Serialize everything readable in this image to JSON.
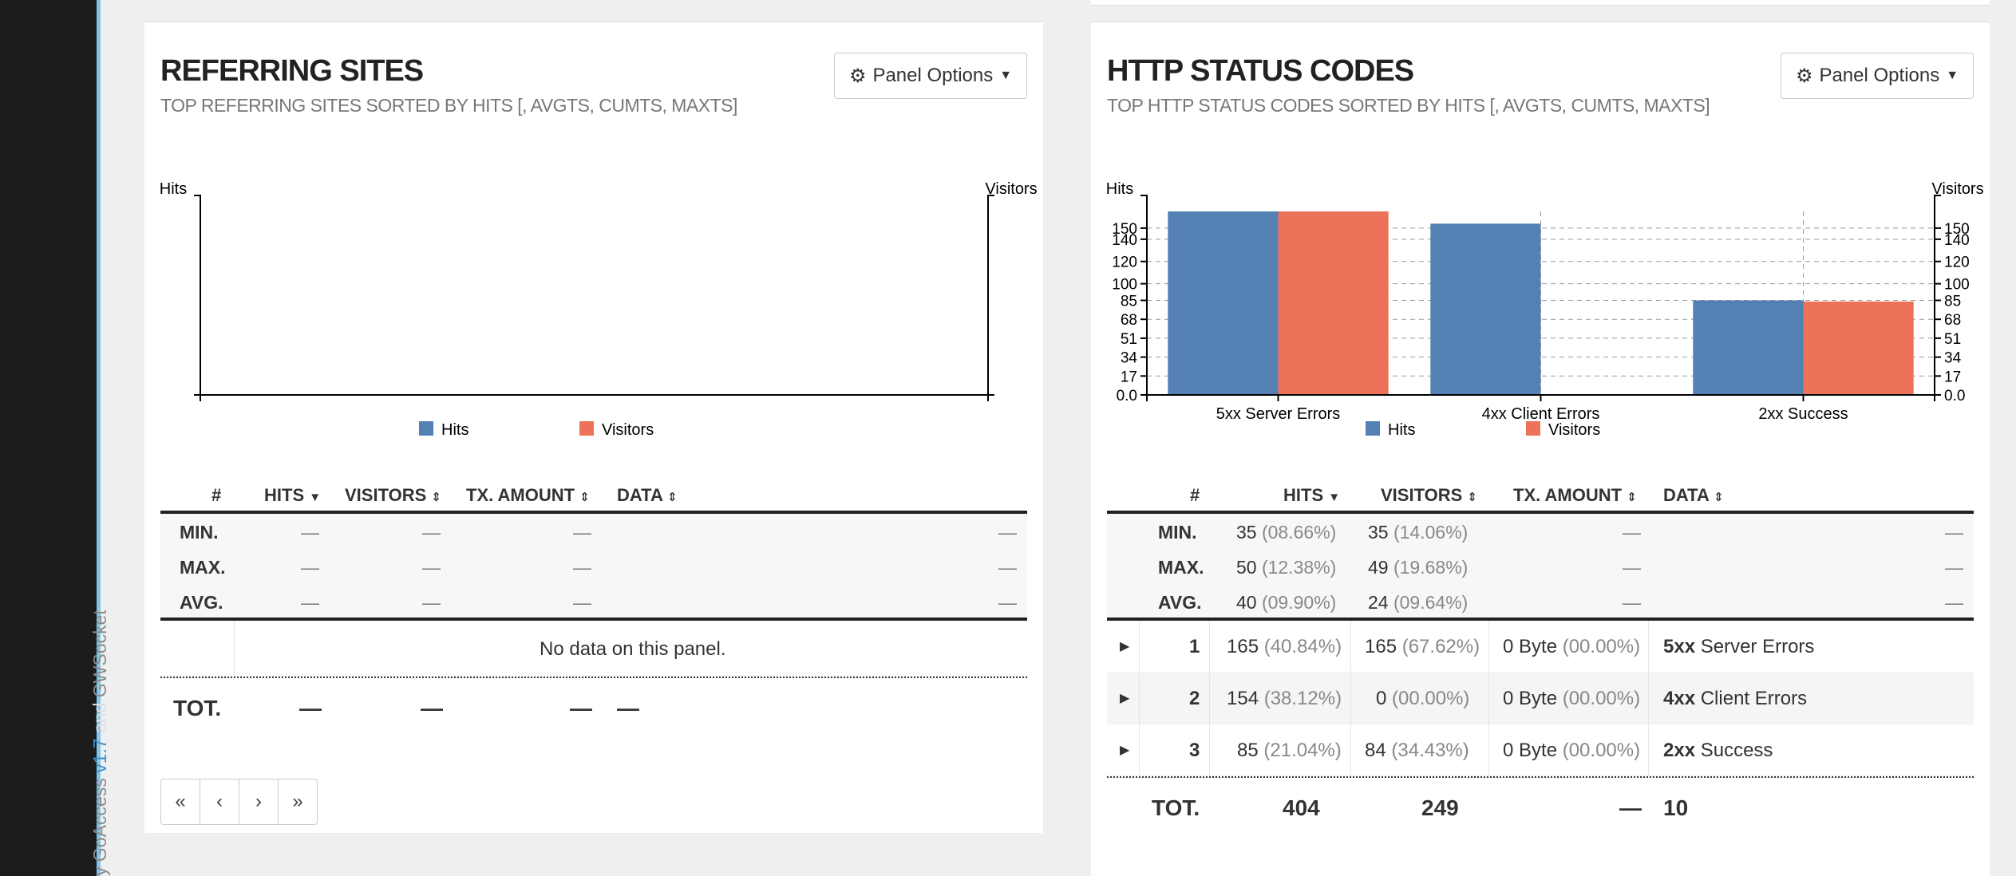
{
  "sidebar": {
    "credit_prefix": "y GoAccess",
    "version": "v1.7",
    "and": "and",
    "credit_suffix": "GWSocket"
  },
  "panels": [
    {
      "title": "REFERRING SITES",
      "subtitle": "TOP REFERRING SITES SORTED BY HITS [, AVGTS, CUMTS, MAXTS]",
      "options_label": "Panel Options",
      "table": {
        "headers": [
          "#",
          "HITS",
          "VISITORS",
          "TX. AMOUNT",
          "DATA"
        ],
        "summary": [
          {
            "label": "MIN.",
            "hits": "—",
            "visitors": "—",
            "tx": "—",
            "data": "—"
          },
          {
            "label": "MAX.",
            "hits": "—",
            "visitors": "—",
            "tx": "—",
            "data": "—"
          },
          {
            "label": "AVG.",
            "hits": "—",
            "visitors": "—",
            "tx": "—",
            "data": "—"
          }
        ],
        "empty_message": "No data on this panel.",
        "total": {
          "label": "TOT.",
          "hits": "—",
          "visitors": "—",
          "tx": "—",
          "data": "—"
        }
      },
      "pager": [
        "«",
        "‹",
        "›",
        "»"
      ]
    },
    {
      "title": "HTTP STATUS CODES",
      "subtitle": "TOP HTTP STATUS CODES SORTED BY HITS [, AVGTS, CUMTS, MAXTS]",
      "options_label": "Panel Options",
      "table": {
        "headers": [
          "#",
          "HITS",
          "VISITORS",
          "TX. AMOUNT",
          "DATA"
        ],
        "summary": [
          {
            "label": "MIN.",
            "hits": "35",
            "hits_pct": "(08.66%)",
            "visitors": "35",
            "visitors_pct": "(14.06%)",
            "tx": "—",
            "data": "—"
          },
          {
            "label": "MAX.",
            "hits": "50",
            "hits_pct": "(12.38%)",
            "visitors": "49",
            "visitors_pct": "(19.68%)",
            "tx": "—",
            "data": "—"
          },
          {
            "label": "AVG.",
            "hits": "40",
            "hits_pct": "(09.90%)",
            "visitors": "24",
            "visitors_pct": "(09.64%)",
            "tx": "—",
            "data": "—"
          }
        ],
        "rows": [
          {
            "num": "1",
            "hits": "165",
            "hits_pct": "(40.84%)",
            "visitors": "165",
            "visitors_pct": "(67.62%)",
            "tx": "0 Byte",
            "tx_pct": "(00.00%)",
            "data_bold": "5xx",
            "data": "Server Errors"
          },
          {
            "num": "2",
            "hits": "154",
            "hits_pct": "(38.12%)",
            "visitors": "0",
            "visitors_pct": "(00.00%)",
            "tx": "0 Byte",
            "tx_pct": "(00.00%)",
            "data_bold": "4xx",
            "data": "Client Errors"
          },
          {
            "num": "3",
            "hits": "85",
            "hits_pct": "(21.04%)",
            "visitors": "84",
            "visitors_pct": "(34.43%)",
            "tx": "0 Byte",
            "tx_pct": "(00.00%)",
            "data_bold": "2xx",
            "data": "Success"
          }
        ],
        "total": {
          "label": "TOT.",
          "hits": "404",
          "visitors": "249",
          "tx": "—",
          "data": "10"
        }
      }
    }
  ],
  "colors": {
    "hits": "#5480b4",
    "visitors": "#ec725a"
  },
  "chart_data": [
    {
      "type": "bar",
      "categories": [],
      "series": [
        {
          "name": "Hits",
          "values": []
        },
        {
          "name": "Visitors",
          "values": []
        }
      ],
      "ylabel_left": "Hits",
      "ylabel_right": "Visitors",
      "legend": "bottom"
    },
    {
      "type": "bar",
      "categories": [
        "5xx Server Errors",
        "4xx Client Errors",
        "2xx Success"
      ],
      "series": [
        {
          "name": "Hits",
          "values": [
            165,
            154,
            85
          ]
        },
        {
          "name": "Visitors",
          "values": [
            165,
            0,
            84
          ]
        }
      ],
      "ylabel_left": "Hits",
      "ylabel_right": "Visitors",
      "yticks_left": [
        "150",
        "140",
        "120",
        "100",
        "85",
        "68",
        "51",
        "34",
        "17",
        "0.0"
      ],
      "yticks_right": [
        "150",
        "140",
        "120",
        "100",
        "85",
        "68",
        "51",
        "34",
        "17",
        "0.0"
      ],
      "ylim": [
        0,
        165
      ],
      "grid": true,
      "legend": "bottom"
    }
  ]
}
